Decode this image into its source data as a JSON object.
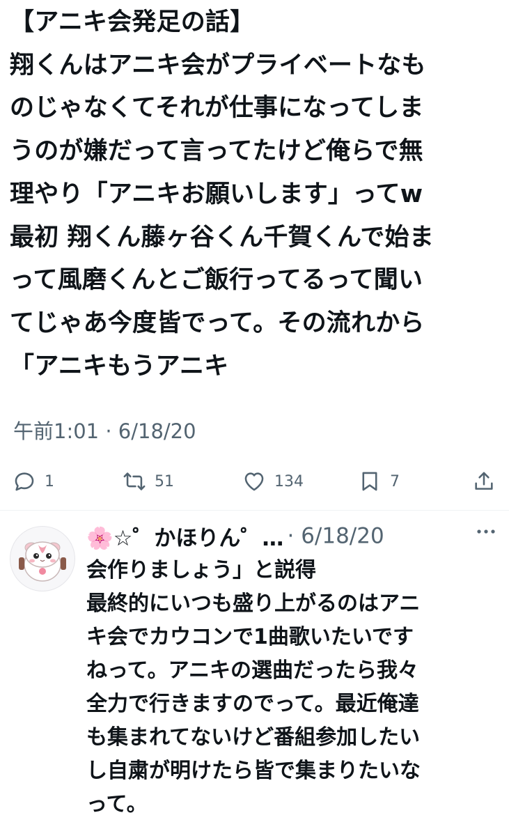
{
  "main_tweet": {
    "text": "【アニキ会発足の話】\n翔くんはアニキ会がプライベートなも\nのじゃなくてそれが仕事になってしま\nうのが嫌だって言ってたけど俺らで無\n理やり「アニキお願いします」ってw\n最初 翔くん藤ヶ谷くん千賀くんで始ま\nって風磨くんとご飯行ってるって聞い\nてじゃあ今度皆でって。その流れから\n「アニキもうアニキ",
    "timestamp": "午前1:01 · 6/18/20",
    "actions": {
      "reply_count": "1",
      "retweet_count": "51",
      "like_count": "134",
      "bookmark_count": "7"
    }
  },
  "reply": {
    "display_name": "🌸☆゜かほりん゜…",
    "meta": "· 6/18/20",
    "text": "会作りましょう」と説得\n最終的にいつも盛り上がるのはアニ\nキ会でカウコンで1曲歌いたいです\nねって。アニキの選曲だったら我々\n全力で行きますのでって。最近俺達\nも集まれてないけど番組参加したい\nし自粛が明けたら皆で集まりたいな\nって。"
  },
  "icons": {
    "reply": "speech-bubble-icon",
    "retweet": "retweet-arrows-icon",
    "like": "heart-icon",
    "bookmark": "bookmark-icon",
    "share": "share-upload-icon",
    "more": "more-dots-icon"
  },
  "colors": {
    "text": "#0f1419",
    "secondary": "#536471",
    "divider": "#eff3f4",
    "background": "#ffffff"
  }
}
